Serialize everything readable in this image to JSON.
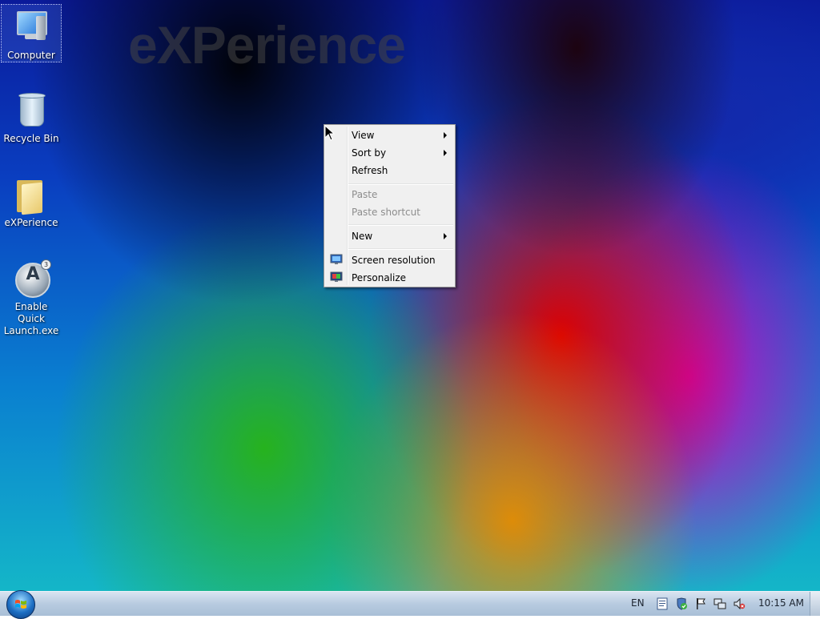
{
  "desktop": {
    "watermark": "eXPerience",
    "icons": [
      {
        "label": "Computer",
        "icon": "computer-icon",
        "selected": true
      },
      {
        "label": "Recycle Bin",
        "icon": "recycle-bin-icon",
        "selected": false
      },
      {
        "label": "eXPerience",
        "icon": "folder-icon",
        "selected": false
      },
      {
        "label": "Enable Quick Launch.exe",
        "icon": "quick-launch-icon",
        "selected": false
      }
    ]
  },
  "context_menu": {
    "items": [
      {
        "label": "View",
        "disabled": false,
        "submenu": true
      },
      {
        "label": "Sort by",
        "disabled": false,
        "submenu": true
      },
      {
        "label": "Refresh",
        "disabled": false,
        "submenu": false
      },
      {
        "label": "Paste",
        "disabled": true,
        "submenu": false
      },
      {
        "label": "Paste shortcut",
        "disabled": true,
        "submenu": false
      },
      {
        "label": "New",
        "disabled": false,
        "submenu": true
      },
      {
        "label": "Screen resolution",
        "disabled": false,
        "submenu": false,
        "icon": "screen-resolution-icon"
      },
      {
        "label": "Personalize",
        "disabled": false,
        "submenu": false,
        "icon": "personalize-icon"
      }
    ]
  },
  "taskbar": {
    "language": "EN",
    "clock": "10:15 AM",
    "tray_icons": [
      "tray-notes-icon",
      "security-shield-icon",
      "action-center-flag-icon",
      "network-icon",
      "volume-muted-icon"
    ]
  },
  "colors": {
    "taskbar_top": "#d9e4f1",
    "taskbar_bottom": "#a9bfd6",
    "menu_bg": "#f0f0f0",
    "disabled_text": "#8d8d8d"
  }
}
